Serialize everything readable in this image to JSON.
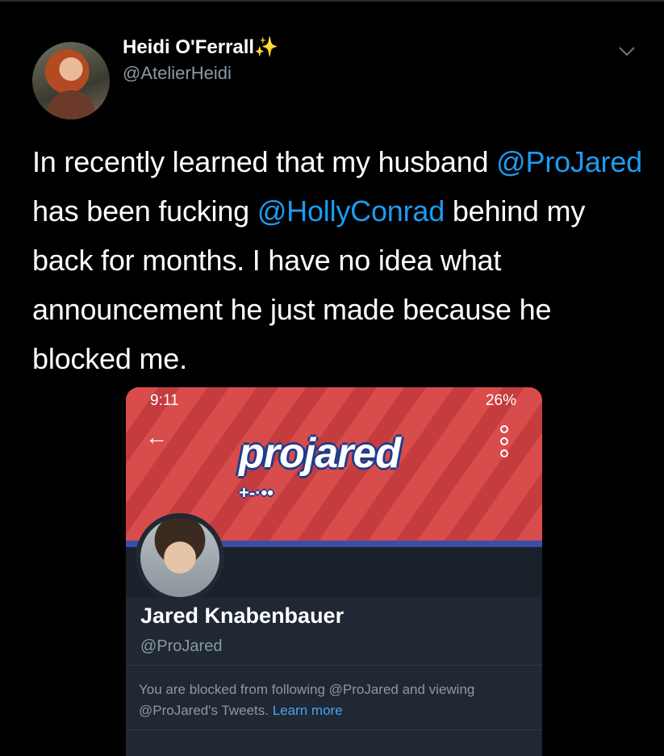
{
  "tweet": {
    "author_name": "Heidi O'Ferrall",
    "author_emoji": "✨",
    "author_handle": "@AtelierHeidi",
    "text_part1": "In recently learned that my husband ",
    "mention1": "@ProJared",
    "text_part2": " has been fucking ",
    "mention2": "@HollyConrad",
    "text_part3": " behind my back for months. I have no idea what announcement he just made because he blocked me."
  },
  "screenshot": {
    "status_time": "9:11",
    "status_right": "26%",
    "banner_logo": "projared",
    "banner_logo_sub": "+-·••",
    "profile_name": "Jared Knabenbauer",
    "profile_handle": "@ProJared",
    "blocked_text": "You are blocked from following @ProJared and viewing @ProJared's Tweets.",
    "learn_more": "Learn more"
  },
  "icons": {
    "more": "chevron-down-icon",
    "back": "arrow-left-icon",
    "menu": "kebab-icon"
  },
  "colors": {
    "background": "#000000",
    "mention": "#1d9bf0",
    "banner": "#d84c4c",
    "profile_bg": "#1f2833"
  }
}
